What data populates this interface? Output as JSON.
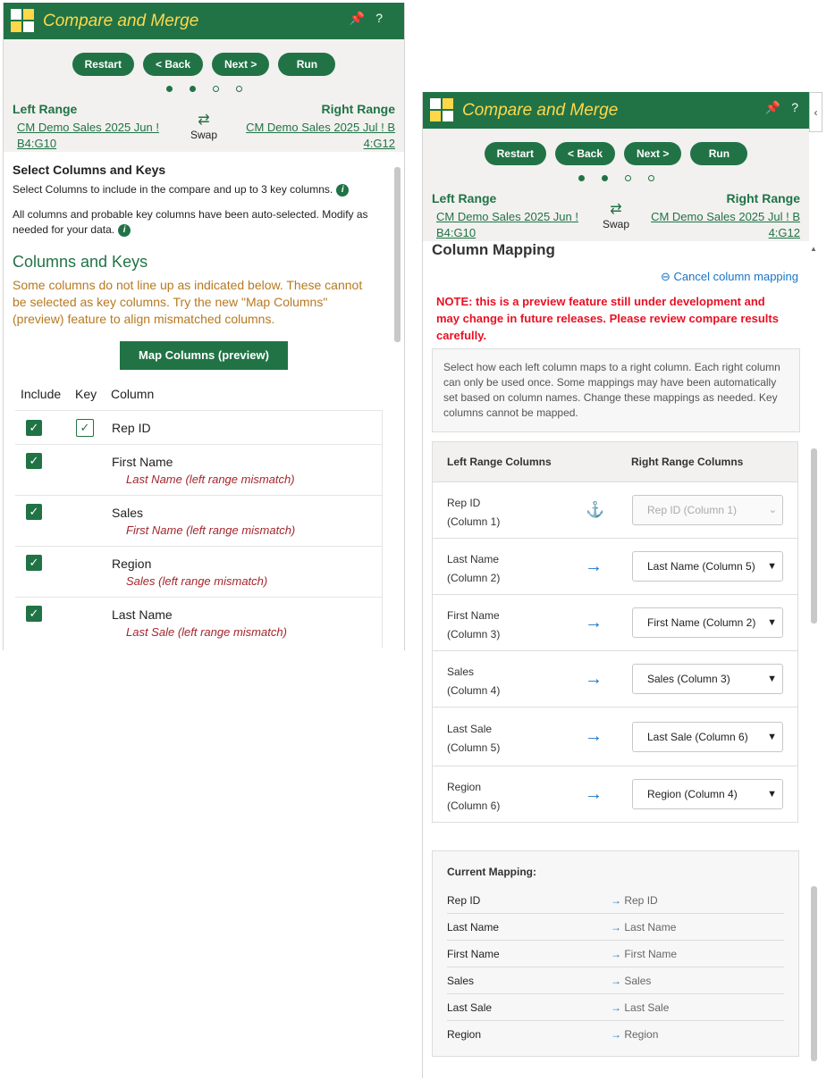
{
  "app_title": "Compare and Merge",
  "header_icons": {
    "pin": "pin-icon",
    "help": "?"
  },
  "buttons": {
    "restart": "Restart",
    "back": "< Back",
    "next": "Next >",
    "run": "Run"
  },
  "ranges": {
    "left_label": "Left Range",
    "right_label": "Right Range",
    "left_link_line1": "CM Demo Sales 2025 Jun !",
    "left_link_line2": "B4:G10",
    "right_link_line1": "CM Demo Sales 2025 Jul ! B",
    "right_link_line2": "4:G12",
    "swap": "Swap"
  },
  "left_pane": {
    "section_title": "Select Columns and Keys",
    "desc1": "Select Columns to include in the compare and up to 3 key columns.",
    "desc2": "All columns and probable key columns have been auto-selected. Modify as needed for your data.",
    "subheading": "Columns and Keys",
    "warning": "Some columns do not line up as indicated below. These cannot be selected as key columns. Try the new \"Map Columns\" (preview) feature to align mismatched columns.",
    "map_button": "Map Columns (preview)",
    "headers": {
      "include": "Include",
      "key": "Key",
      "column": "Column"
    },
    "rows": [
      {
        "name": "Rep ID",
        "mismatch": ""
      },
      {
        "name": "First Name",
        "mismatch": "Last Name (left range mismatch)"
      },
      {
        "name": "Sales",
        "mismatch": "First Name (left range mismatch)"
      },
      {
        "name": "Region",
        "mismatch": "Sales (left range mismatch)"
      },
      {
        "name": "Last Name",
        "mismatch": "Last Sale (left range mismatch)"
      }
    ]
  },
  "right_pane": {
    "section_title": "Column Mapping",
    "cancel": "Cancel column mapping",
    "note": "NOTE: this is a preview feature still under development and may change in future releases. Please review compare results carefully.",
    "instructions": "Select how each left column maps to a right column. Each right column can only be used once. Some mappings may have been automatically set based on column names. Change these mappings as needed. Key columns cannot be mapped.",
    "col_left": "Left Range Columns",
    "col_right": "Right Range Columns",
    "mappings": [
      {
        "left": "Rep ID",
        "sub": "(Column 1)",
        "right": "Rep ID (Column 1)"
      },
      {
        "left": "Last Name",
        "sub": "(Column 2)",
        "right": "Last Name (Column 5)"
      },
      {
        "left": "First Name",
        "sub": "(Column 3)",
        "right": "First Name (Column 2)"
      },
      {
        "left": "Sales",
        "sub": "(Column 4)",
        "right": "Sales (Column 3)"
      },
      {
        "left": "Last Sale",
        "sub": "(Column 5)",
        "right": "Last Sale (Column 6)"
      },
      {
        "left": "Region",
        "sub": "(Column 6)",
        "right": "Region (Column 4)"
      }
    ],
    "current_title": "Current Mapping:",
    "current": [
      {
        "from": "Rep ID",
        "to": "Rep ID"
      },
      {
        "from": "Last Name",
        "to": "Last Name"
      },
      {
        "from": "First Name",
        "to": "First Name"
      },
      {
        "from": "Sales",
        "to": "Sales"
      },
      {
        "from": "Last Sale",
        "to": "Last Sale"
      },
      {
        "from": "Region",
        "to": "Region"
      }
    ]
  },
  "colors": {
    "brand": "#217346",
    "title": "#ffd84a",
    "warning": "#b7791f",
    "mismatch": "#a4262c",
    "note": "#e81123",
    "link": "#1b74c5"
  }
}
